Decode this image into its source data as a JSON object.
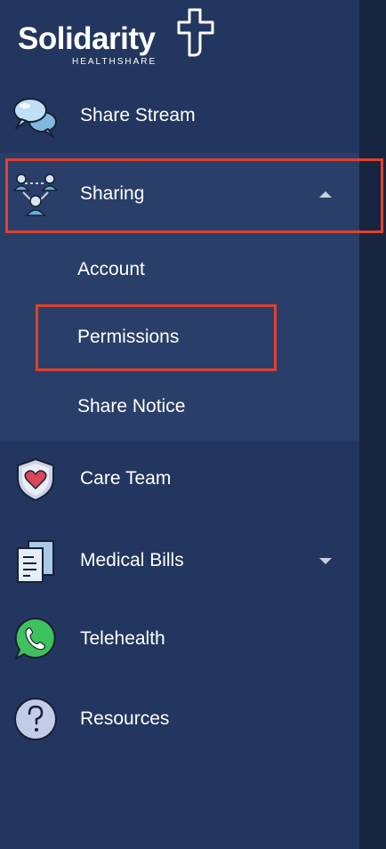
{
  "brand": {
    "name": "Solidarity",
    "tagline": "HEALTHSHARE"
  },
  "nav": {
    "share_stream": {
      "label": "Share Stream",
      "icon": "chat-bubbles-icon"
    },
    "sharing": {
      "label": "Sharing",
      "icon": "people-network-icon",
      "expanded": true,
      "items": [
        {
          "label": "Account"
        },
        {
          "label": "Permissions"
        },
        {
          "label": "Share Notice"
        }
      ]
    },
    "care_team": {
      "label": "Care Team",
      "icon": "heart-shield-icon"
    },
    "medical_bills": {
      "label": "Medical Bills",
      "icon": "documents-icon",
      "expanded": false
    },
    "telehealth": {
      "label": "Telehealth",
      "icon": "phone-bubble-icon"
    },
    "resources": {
      "label": "Resources",
      "icon": "question-circle-icon"
    }
  },
  "colors": {
    "sidebar": "#22365f",
    "submenu": "#293f69",
    "highlight": "#e0402c"
  }
}
